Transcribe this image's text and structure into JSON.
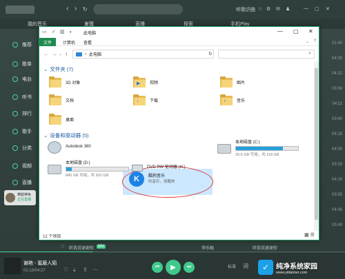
{
  "music_app": {
    "nav": {
      "back": "‹",
      "forward": "›",
      "refresh": "↻"
    },
    "top_right": {
      "recognize": "听歌识曲",
      "items": [
        "☆",
        "⚙",
        "✉",
        "♟"
      ],
      "window": [
        "—",
        "▢",
        "✕"
      ]
    },
    "tabs": [
      "我的音乐",
      "发现",
      "直播",
      "探索",
      "手机Play"
    ],
    "sidebar": [
      {
        "label": "推荐"
      },
      {
        "label": "歌单"
      },
      {
        "label": "电台"
      },
      {
        "label": "听书"
      },
      {
        "label": "排行"
      },
      {
        "label": "歌手"
      },
      {
        "label": "分类"
      },
      {
        "label": "视频"
      },
      {
        "label": "直播"
      }
    ],
    "mini_card": {
      "name": "舞蹈神免",
      "status": "正在直播"
    },
    "right_times": [
      "01:40",
      "04:35",
      "04:22",
      "03:58",
      "04:11",
      "03:40",
      "04:18",
      "04:05",
      "03:33",
      "04:29",
      "03:55",
      "04:06",
      "03:49"
    ],
    "strip": {
      "left": "听我说谢谢你",
      "tag": "MV",
      "mid": "李乐融",
      "right": "听我说谢谢你"
    },
    "player": {
      "song": "谢艳 - 蜜磨人陌",
      "time": "01:13/04:27",
      "progress": 0.27,
      "controls": {
        "prev": "⏮",
        "play": "▶",
        "next": "⏭"
      },
      "quality": "标准",
      "lyric": "词"
    }
  },
  "explorer": {
    "title": "此电脑",
    "ribbon_tabs": [
      "文件",
      "计算机",
      "查看"
    ],
    "address_path": "此电脑",
    "search_placeholder": "搜索\"此电脑\"",
    "folders_header": "文件夹 (7)",
    "folders": [
      {
        "name": "3D 对象",
        "badge": ""
      },
      {
        "name": "视频",
        "badge": "▶"
      },
      {
        "name": "图片",
        "badge": ""
      },
      {
        "name": "文档",
        "badge": ""
      },
      {
        "name": "下载",
        "badge": "↓"
      },
      {
        "name": "音乐",
        "badge": "♪"
      },
      {
        "name": "桌面",
        "badge": ""
      }
    ],
    "drives_header": "设备和驱动器 (5)",
    "drives": [
      {
        "name": "Autodesk 360"
      },
      {
        "name": "本地磁盘 (C:)",
        "free": "29.6 GB 可用，共 118 GB",
        "used": 0.75
      },
      {
        "name": "本地磁盘 (D:)",
        "free": "845 GB 可用，共 931 GB",
        "used": 0.09
      },
      {
        "name": "DVD RW 驱动器 (H:)"
      }
    ],
    "kugou": {
      "name": "酷狗音乐",
      "desc": "听音乐，用酷狗",
      "icon": "K"
    },
    "status_count": "12 个项目",
    "views": "▦ ☰"
  },
  "watermark": {
    "title": "纯净系统家园",
    "url": "www.yidaimei.com",
    "icon": "✓"
  }
}
